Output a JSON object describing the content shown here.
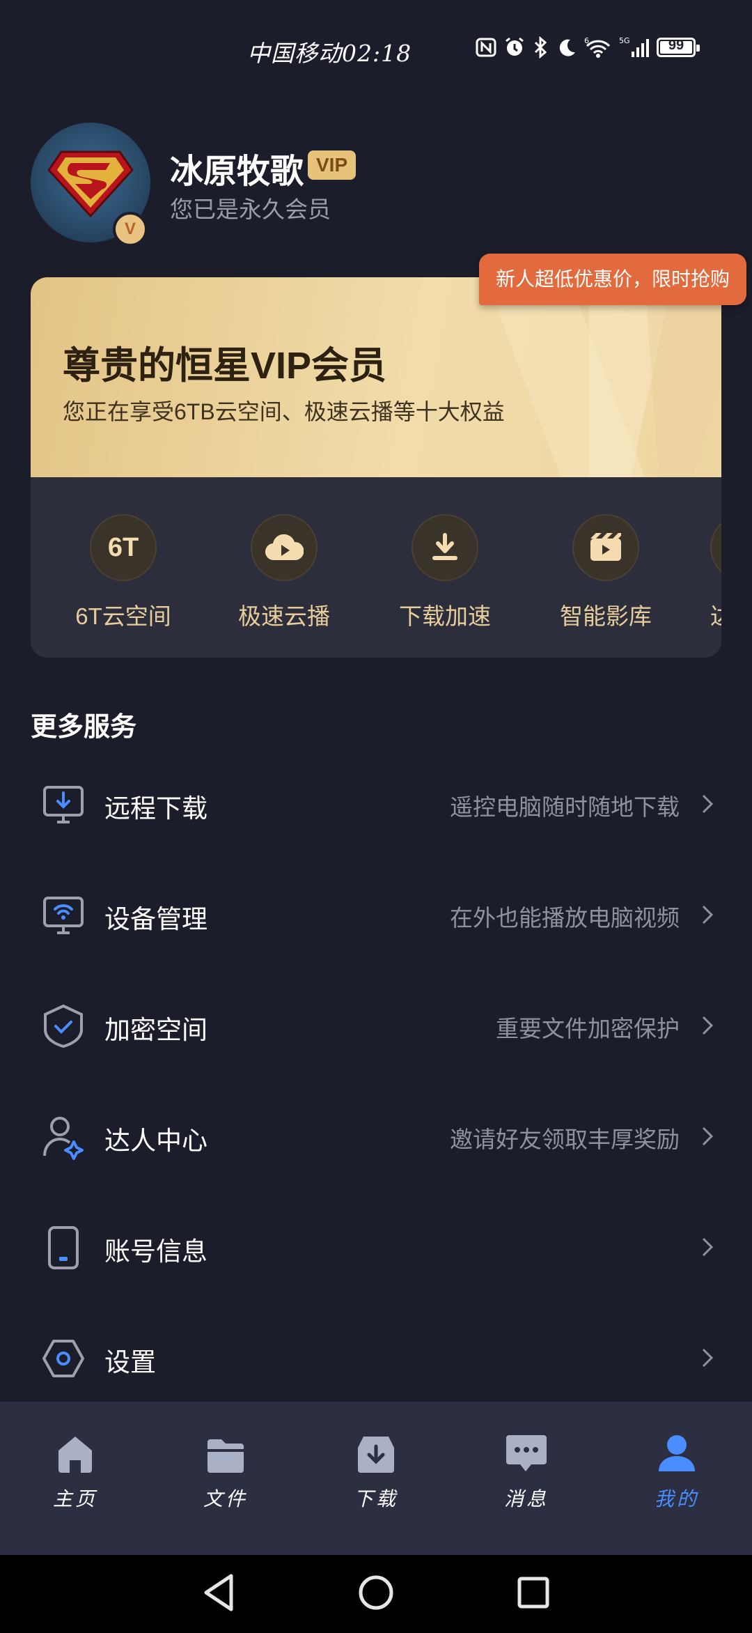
{
  "status_bar": {
    "carrier_time": "中国移动02:18",
    "network": "5G",
    "wifi": "6",
    "battery": "99",
    "icons": [
      "nfc-icon",
      "alarm-icon",
      "bluetooth-icon",
      "moon-icon",
      "wifi-icon",
      "signal-icon",
      "battery-icon"
    ]
  },
  "profile": {
    "name": "冰原牧歌",
    "vip_tag": "VIP",
    "subtitle": "您已是永久会员"
  },
  "vip_card": {
    "promo_badge": "新人超低优惠价，限时抢购",
    "title": "尊贵的恒星VIP会员",
    "description": "您正在享受6TB云空间、极速云播等十大权益",
    "benefits": [
      {
        "label": "6T云空间",
        "icon_text": "6T",
        "icon": "6t-icon"
      },
      {
        "label": "极速云播",
        "icon": "cloud-play-icon"
      },
      {
        "label": "下载加速",
        "icon": "download-icon"
      },
      {
        "label": "智能影库",
        "icon": "film-icon"
      },
      {
        "label": "达",
        "icon": "partial-icon"
      }
    ]
  },
  "services": {
    "title": "更多服务",
    "items": [
      {
        "label": "远程下载",
        "desc": "遥控电脑随时随地下载",
        "icon": "remote-download-icon"
      },
      {
        "label": "设备管理",
        "desc": "在外也能播放电脑视频",
        "icon": "device-icon"
      },
      {
        "label": "加密空间",
        "desc": "重要文件加密保护",
        "icon": "shield-icon"
      },
      {
        "label": "达人中心",
        "desc": "邀请好友领取丰厚奖励",
        "icon": "user-star-icon"
      },
      {
        "label": "账号信息",
        "desc": "",
        "icon": "phone-account-icon"
      },
      {
        "label": "设置",
        "desc": "",
        "icon": "settings-icon"
      }
    ]
  },
  "tabs": [
    {
      "label": "主页",
      "icon": "home-icon"
    },
    {
      "label": "文件",
      "icon": "folder-icon"
    },
    {
      "label": "下载",
      "icon": "download-tray-icon"
    },
    {
      "label": "消息",
      "icon": "message-icon"
    },
    {
      "label": "我的",
      "icon": "profile-icon",
      "active": true
    }
  ],
  "colors": {
    "background": "#1c1d2b",
    "accent": "#4b8dff",
    "gold": "#e7c27a",
    "promo": "#e26a3c"
  }
}
